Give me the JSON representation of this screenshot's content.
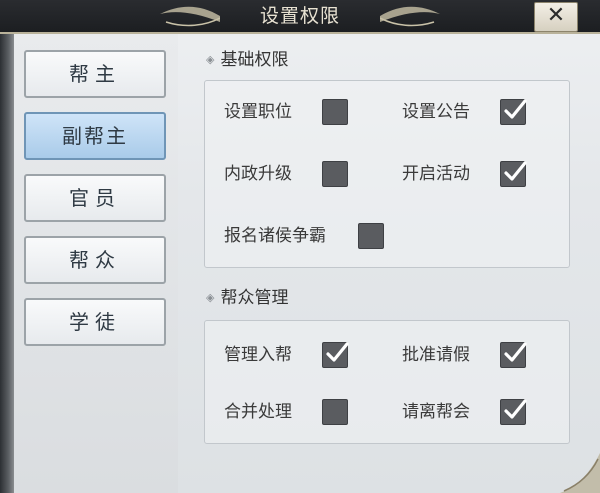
{
  "window": {
    "title": "设置权限",
    "close_label": "✕"
  },
  "sidebar": {
    "items": [
      {
        "label": "帮主",
        "active": false
      },
      {
        "label": "副帮主",
        "active": true
      },
      {
        "label": "官员",
        "active": false
      },
      {
        "label": "帮众",
        "active": false
      },
      {
        "label": "学徒",
        "active": false
      }
    ]
  },
  "sections": [
    {
      "title": "基础权限",
      "permissions": [
        {
          "label": "设置职位",
          "checked": false
        },
        {
          "label": "设置公告",
          "checked": true
        },
        {
          "label": "内政升级",
          "checked": false
        },
        {
          "label": "开启活动",
          "checked": true
        },
        {
          "label": "报名诸侯争霸",
          "checked": false
        }
      ]
    },
    {
      "title": "帮众管理",
      "permissions": [
        {
          "label": "管理入帮",
          "checked": true
        },
        {
          "label": "批准请假",
          "checked": true
        },
        {
          "label": "合并处理",
          "checked": false
        },
        {
          "label": "请离帮会",
          "checked": true
        }
      ]
    }
  ],
  "icons": {
    "section_marker": "diamond-icon",
    "check": "checkmark-icon",
    "close": "close-icon"
  },
  "colors": {
    "active_tab": "#a9cbe9",
    "checkbox": "#5a5c60",
    "title_bar": "#1c1e21"
  }
}
